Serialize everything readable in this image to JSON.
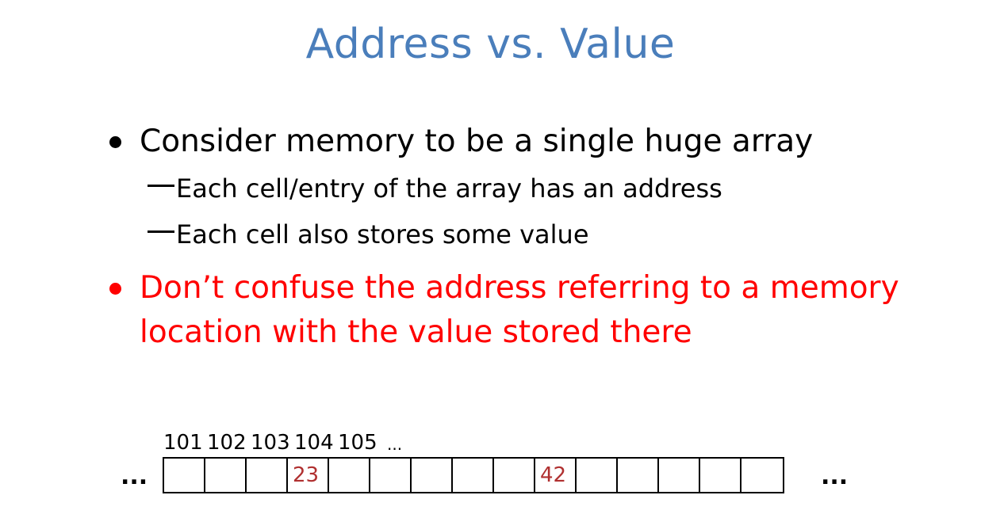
{
  "title": "Address vs. Value",
  "bullets": [
    "Consider memory to be a single huge array",
    "Don’t confuse the address referring to a memory location with the value stored there"
  ],
  "subbullets": [
    "Each cell/entry of the array has an address",
    "Each cell also stores some value"
  ],
  "addresses": [
    "101",
    "102",
    "103",
    "104",
    "105",
    "..."
  ],
  "cells": [
    "",
    "",
    "",
    "23",
    "",
    "",
    "",
    "",
    "",
    "42",
    "",
    "",
    "",
    "",
    ""
  ],
  "ellipsis": "...",
  "colors": {
    "title": "#4a7ebb",
    "highlight": "#ff0000",
    "cell_value": "#b03030"
  }
}
